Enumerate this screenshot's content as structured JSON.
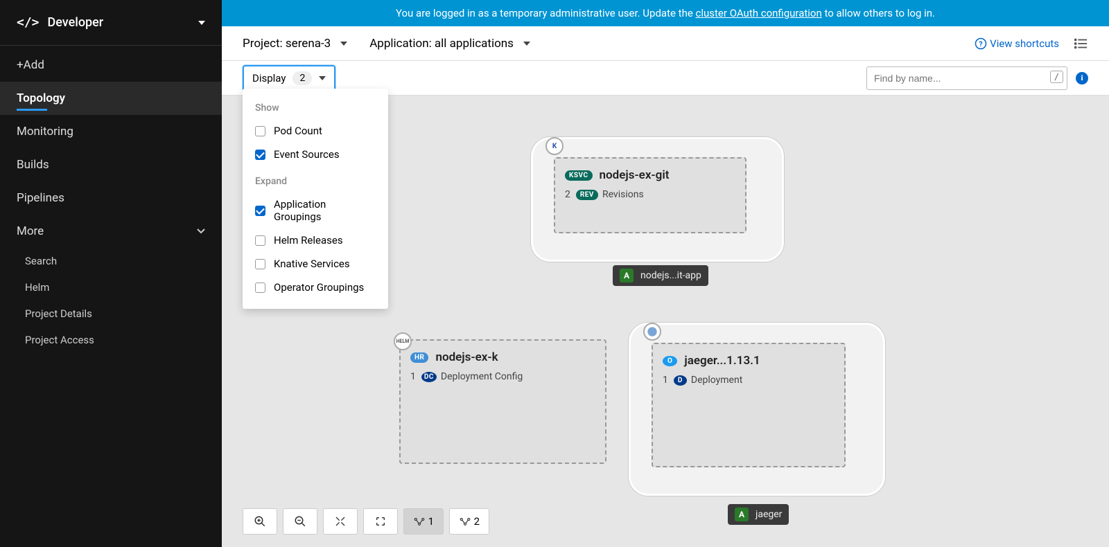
{
  "banner": {
    "text_before": "You are logged in as a temporary administrative user. Update the ",
    "link_text": "cluster OAuth configuration",
    "text_after": " to allow others to log in."
  },
  "sidebar": {
    "perspective": "Developer",
    "items": [
      {
        "label": "+Add"
      },
      {
        "label": "Topology"
      },
      {
        "label": "Monitoring"
      },
      {
        "label": "Builds"
      },
      {
        "label": "Pipelines"
      },
      {
        "label": "More"
      }
    ],
    "more_items": [
      {
        "label": "Search"
      },
      {
        "label": "Helm"
      },
      {
        "label": "Project Details"
      },
      {
        "label": "Project Access"
      }
    ]
  },
  "toolbar": {
    "project_label": "Project:",
    "project_value": "serena-3",
    "app_label": "Application:",
    "app_value": "all applications",
    "shortcuts": "View shortcuts"
  },
  "display": {
    "label": "Display",
    "count": "2"
  },
  "search": {
    "placeholder": "Find by name...",
    "shortcut": "/"
  },
  "dropdown": {
    "show_header": "Show",
    "expand_header": "Expand",
    "show": [
      {
        "label": "Pod Count",
        "checked": false
      },
      {
        "label": "Event Sources",
        "checked": true
      }
    ],
    "expand": [
      {
        "label": "Application Groupings",
        "checked": true
      },
      {
        "label": "Helm Releases",
        "checked": false
      },
      {
        "label": "Knative Services",
        "checked": false
      },
      {
        "label": "Operator Groupings",
        "checked": false
      }
    ]
  },
  "nodes": {
    "ksvc": {
      "badge": "KSVC",
      "title": "nodejs-ex-git",
      "rev_count": "2",
      "rev_badge": "REV",
      "rev_label": "Revisions",
      "app_label": "nodejs...it-app",
      "corner": "K"
    },
    "helm": {
      "badge": "HR",
      "title": "nodejs-ex-k",
      "count": "1",
      "sub_badge": "DC",
      "sub_label": "Deployment Config",
      "corner": "HELM"
    },
    "jaeger": {
      "badge": "O",
      "title": "jaeger...1.13.1",
      "count": "1",
      "sub_badge": "D",
      "sub_label": "Deployment",
      "app_label": "jaeger"
    }
  },
  "controls": {
    "graph1": "1",
    "graph2": "2"
  }
}
